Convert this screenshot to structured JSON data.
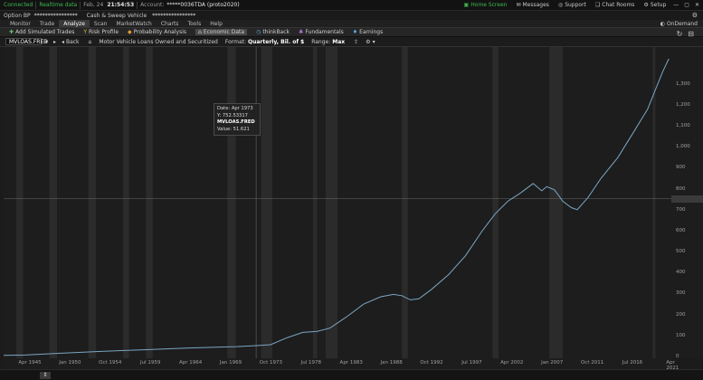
{
  "status_bar": {
    "connected": "Connected",
    "realtime": "Realtime data",
    "date": "Feb, 24",
    "time": "21:54:53",
    "account_label": "Account:",
    "account_value": "*****0036TDA (proto2020)",
    "home_screen": "Home Screen",
    "messages": "Messages",
    "support": "Support",
    "chat_rooms": "Chat Rooms",
    "setup": "Setup"
  },
  "account_bar": {
    "option": "Option BP",
    "option_value": "****************",
    "cash_label": "Cash & Sweep Vehicle",
    "cash_value": "****************"
  },
  "nav": {
    "tabs": [
      "Monitor",
      "Trade",
      "Analyze",
      "Scan",
      "MarketWatch",
      "Charts",
      "Tools",
      "Help"
    ],
    "active": "Analyze",
    "ondemand": "OnDemand"
  },
  "tools": {
    "items": [
      "Add Simulated Trades",
      "Risk Profile",
      "Probability Analysis",
      "Economic Data",
      "thinkBack",
      "Fundamentals",
      "Earnings"
    ],
    "active": "Economic Data"
  },
  "chart_header": {
    "symbol": "MVLOAS.FRED",
    "back": "Back",
    "title": "Motor Vehicle Loans Owned and Securitized",
    "format_label": "Format:",
    "format_value": "Quarterly, Bil. of $",
    "range_label": "Range:",
    "range_value": "Max"
  },
  "tooltip": {
    "date_label": "Date:",
    "date_value": "Apr 1973",
    "y_label": "Y:",
    "y_value": "752.53317",
    "series": "MVLOAS.FRED",
    "value_label": "Value:",
    "value_value": "51.621"
  },
  "chart_data": {
    "type": "line",
    "x_ticks": [
      "Apr 1945",
      "Jan 1950",
      "Oct 1954",
      "Jul 1959",
      "Apr 1964",
      "Jan 1969",
      "Oct 1973",
      "Jul 1978",
      "Apr 1983",
      "Jan 1988",
      "Oct 1992",
      "Jul 1997",
      "Apr 2002",
      "Jan 2007",
      "Oct 2011",
      "Jul 2016",
      "Apr 2021"
    ],
    "y_ticks": [
      0,
      100,
      200,
      300,
      400,
      500,
      600,
      700,
      800,
      900,
      1000,
      1100,
      1200,
      1300
    ],
    "ylim": [
      0,
      1450
    ],
    "xlim": [
      1943.5,
      2022.3
    ],
    "series": [
      {
        "color": "#7aa6c4",
        "x": [
          1943.5,
          1946,
          1950,
          1955,
          1960,
          1965,
          1969,
          1971,
          1973.3,
          1975,
          1977,
          1978.8,
          1980.5,
          1982,
          1984,
          1986,
          1988,
          1989.5,
          1990.5,
          1991.5,
          1992.5,
          1994,
          1996,
          1998,
          2000,
          2001.5,
          2003,
          2004.5,
          2006,
          2007,
          2007.6,
          2008.5,
          2009.5,
          2010.5,
          2011.2,
          2012.5,
          2014,
          2016,
          2018,
          2019.5,
          2020.5,
          2021.3,
          2022
        ],
        "y": [
          5,
          7,
          15,
          24,
          32,
          40,
          45,
          47,
          51.6,
          56,
          90,
          115,
          120,
          135,
          190,
          250,
          285,
          296,
          290,
          270,
          275,
          320,
          390,
          480,
          600,
          680,
          740,
          780,
          825,
          790,
          810,
          795,
          740,
          710,
          700,
          760,
          850,
          950,
          1080,
          1180,
          1280,
          1360,
          1420
        ]
      }
    ],
    "crosshair": {
      "x": 1973.3,
      "y": 752.53
    },
    "recessions": [
      [
        1945.0,
        1945.8
      ],
      [
        1948.9,
        1949.8
      ],
      [
        1953.5,
        1954.4
      ],
      [
        1957.6,
        1958.3
      ],
      [
        1960.3,
        1961.1
      ],
      [
        1969.9,
        1970.9
      ],
      [
        1973.9,
        1975.2
      ],
      [
        1980.0,
        1980.5
      ],
      [
        1981.5,
        1982.9
      ],
      [
        1990.5,
        1991.2
      ],
      [
        2001.2,
        2001.9
      ],
      [
        2007.9,
        2009.5
      ],
      [
        2020.1,
        2020.4
      ]
    ]
  }
}
